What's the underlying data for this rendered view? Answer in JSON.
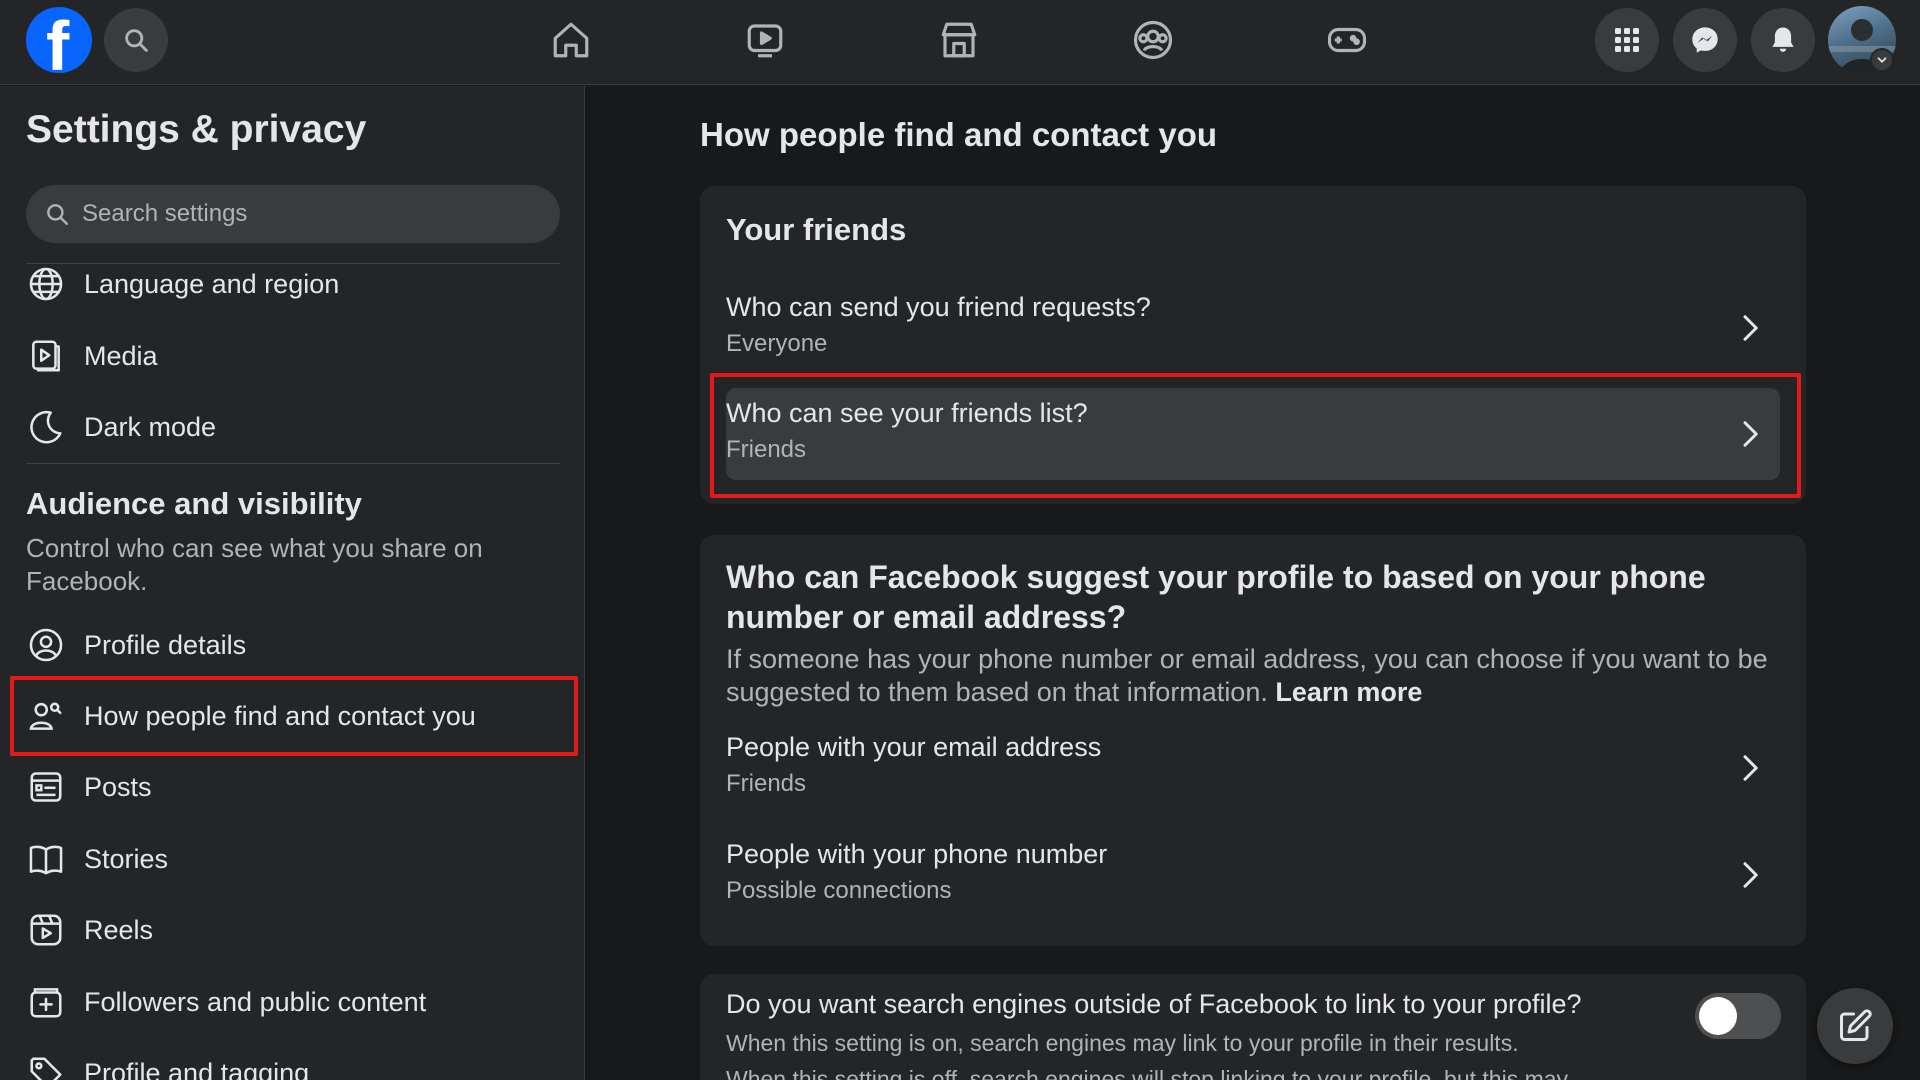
{
  "topbar": {
    "logo_letter": "f",
    "nav_icons": [
      "home-icon",
      "video-icon",
      "marketplace-icon",
      "groups-icon",
      "gaming-icon"
    ],
    "right_icons": [
      "menu-grid-icon",
      "messenger-icon",
      "notifications-icon"
    ]
  },
  "sidebar": {
    "title": "Settings & privacy",
    "search_placeholder": "Search settings",
    "top_items": [
      {
        "label": "Language and region",
        "icon": "globe-icon"
      },
      {
        "label": "Media",
        "icon": "media-icon"
      },
      {
        "label": "Dark mode",
        "icon": "moon-icon"
      }
    ],
    "section_title": "Audience and visibility",
    "section_desc": "Control who can see what you share on Facebook.",
    "section_items": [
      {
        "label": "Profile details",
        "icon": "profile-icon"
      },
      {
        "label": "How people find and contact you",
        "icon": "people-search-icon",
        "active": true
      },
      {
        "label": "Posts",
        "icon": "posts-icon"
      },
      {
        "label": "Stories",
        "icon": "stories-icon"
      },
      {
        "label": "Reels",
        "icon": "reels-icon"
      },
      {
        "label": "Followers and public content",
        "icon": "followers-icon"
      },
      {
        "label": "Profile and tagging",
        "icon": "tag-icon"
      }
    ]
  },
  "main": {
    "title": "How people find and contact you",
    "friends_card": {
      "heading": "Your friends",
      "rows": [
        {
          "question": "Who can send you friend requests?",
          "answer": "Everyone"
        },
        {
          "question": "Who can see your friends list?",
          "answer": "Friends"
        }
      ]
    },
    "suggest_card": {
      "title": "Who can Facebook suggest your profile to based on your phone number or email address?",
      "desc": "If someone has your phone number or email address, you can choose if you want to be suggested to them based on that information.",
      "learn_more": "Learn more",
      "rows": [
        {
          "question": "People with your email address",
          "answer": "Friends"
        },
        {
          "question": "People with your phone number",
          "answer": "Possible connections"
        }
      ]
    },
    "search_engine_card": {
      "question": "Do you want search engines outside of Facebook to link to your profile?",
      "desc1": "When this setting is on, search engines may link to your profile in their results.",
      "desc2": "When this setting is off, search engines will stop linking to your profile, but this may",
      "toggle_on": false
    }
  },
  "colors": {
    "background": "#18191a",
    "surface": "#242526",
    "hover": "#3a3b3c",
    "brand": "#0866ff",
    "highlight": "#e41a1a"
  }
}
